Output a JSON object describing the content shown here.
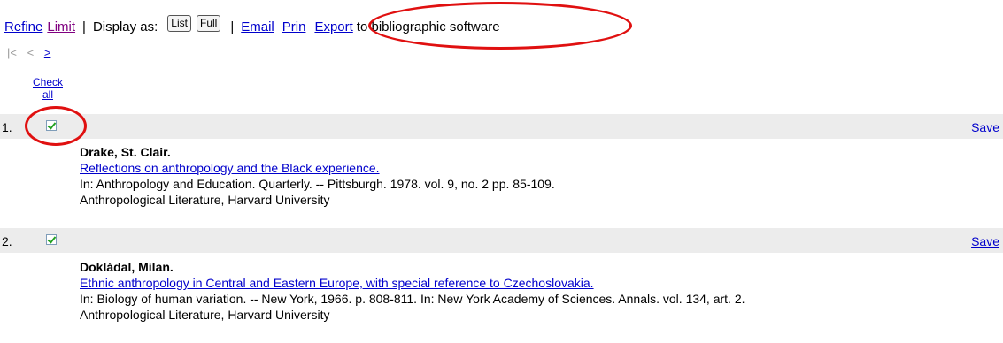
{
  "toolbar": {
    "refine": "Refine",
    "limit": "Limit",
    "separator": "|",
    "display_as": "Display as:",
    "list_button": "List",
    "full_button": "Full",
    "email": "Email",
    "print": "Prin",
    "export": "Export",
    "export_suffix": "to bibliographic software"
  },
  "pager": {
    "first": "|<",
    "prev": "<",
    "next": ">"
  },
  "check_all": "Check all",
  "records": [
    {
      "number": "1.",
      "checked": true,
      "save": "Save",
      "author": "Drake, St. Clair.",
      "title": "Reflections on anthropology and the Black experience.",
      "citation": "In: Anthropology and Education. Quarterly. -- Pittsburgh. 1978. vol. 9, no. 2 pp. 85-109.",
      "source": "Anthropological Literature, Harvard University"
    },
    {
      "number": "2.",
      "checked": true,
      "save": "Save",
      "author": "Dokládal, Milan.",
      "title": "Ethnic anthropology in Central and Eastern Europe, with special reference to Czechoslovakia.",
      "citation": "In: Biology of human variation. -- New York, 1966. p. 808-811. In: New York Academy of Sciences. Annals. vol. 134, art. 2.",
      "source": "Anthropological Literature, Harvard University"
    }
  ],
  "annotation_color": "#e01010"
}
